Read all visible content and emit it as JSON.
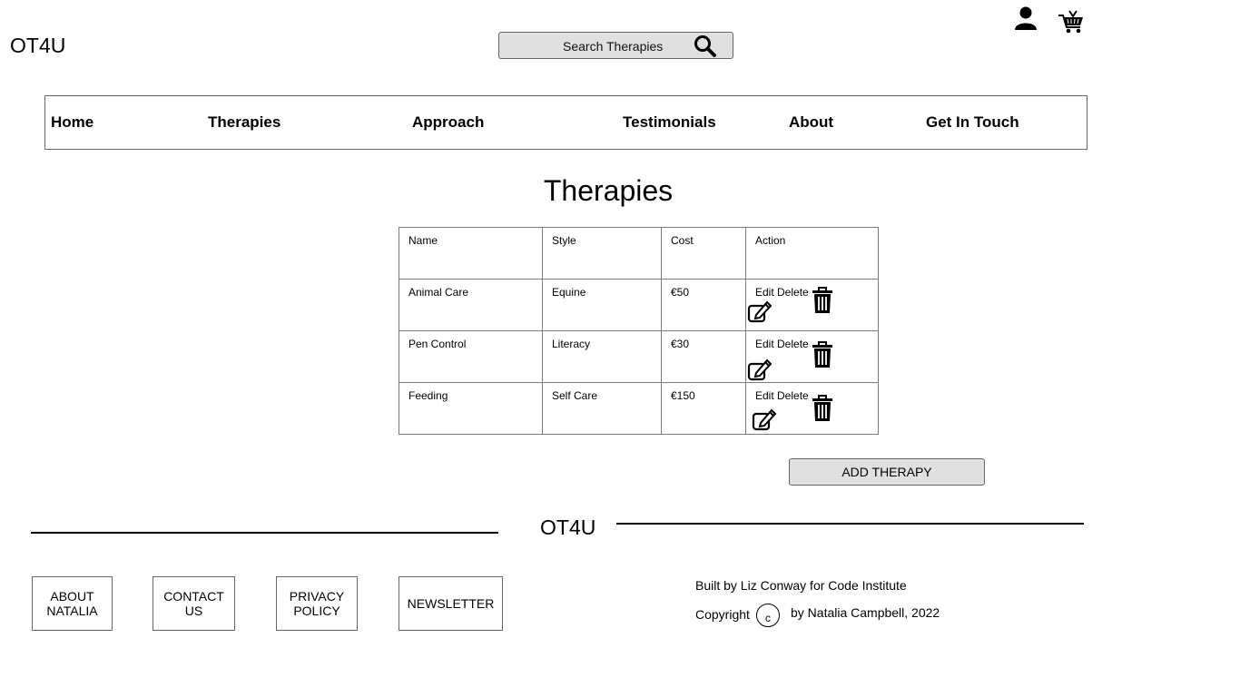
{
  "header": {
    "logo": "OT4U",
    "search_placeholder": "Search Therapies"
  },
  "nav": [
    {
      "label": "Home"
    },
    {
      "label": "Therapies"
    },
    {
      "label": "Approach"
    },
    {
      "label": "Testimonials"
    },
    {
      "label": "About"
    },
    {
      "label": "Get In Touch"
    }
  ],
  "main": {
    "title": "Therapies",
    "table": {
      "headers": [
        "Name",
        "Style",
        "Cost",
        "Action"
      ],
      "rows": [
        {
          "name": "Animal Care",
          "style": "Equine",
          "cost": "€50",
          "action": "Edit Delete"
        },
        {
          "name": "Pen Control",
          "style": "Literacy",
          "cost": "€30",
          "action": "Edit Delete"
        },
        {
          "name": "Feeding",
          "style": "Self Care",
          "cost": "€150",
          "action": "Edit Delete"
        }
      ]
    },
    "add_button": "ADD THERAPY"
  },
  "footer": {
    "logo": "OT4U",
    "links": [
      {
        "line1": "ABOUT",
        "line2": "NATALIA"
      },
      {
        "line1": "CONTACT",
        "line2": "US"
      },
      {
        "line1": "PRIVACY",
        "line2": "POLICY"
      },
      {
        "line1": "NEWSLETTER",
        "line2": ""
      }
    ],
    "credit": "Built by Liz Conway for Code Institute",
    "copyright_label": "Copyright",
    "copyright_symbol": "c",
    "copyright_by": "by Natalia Campbell, 2022"
  },
  "icons": [
    "search-icon",
    "user-icon",
    "cart-icon",
    "edit-icon",
    "trash-icon"
  ]
}
